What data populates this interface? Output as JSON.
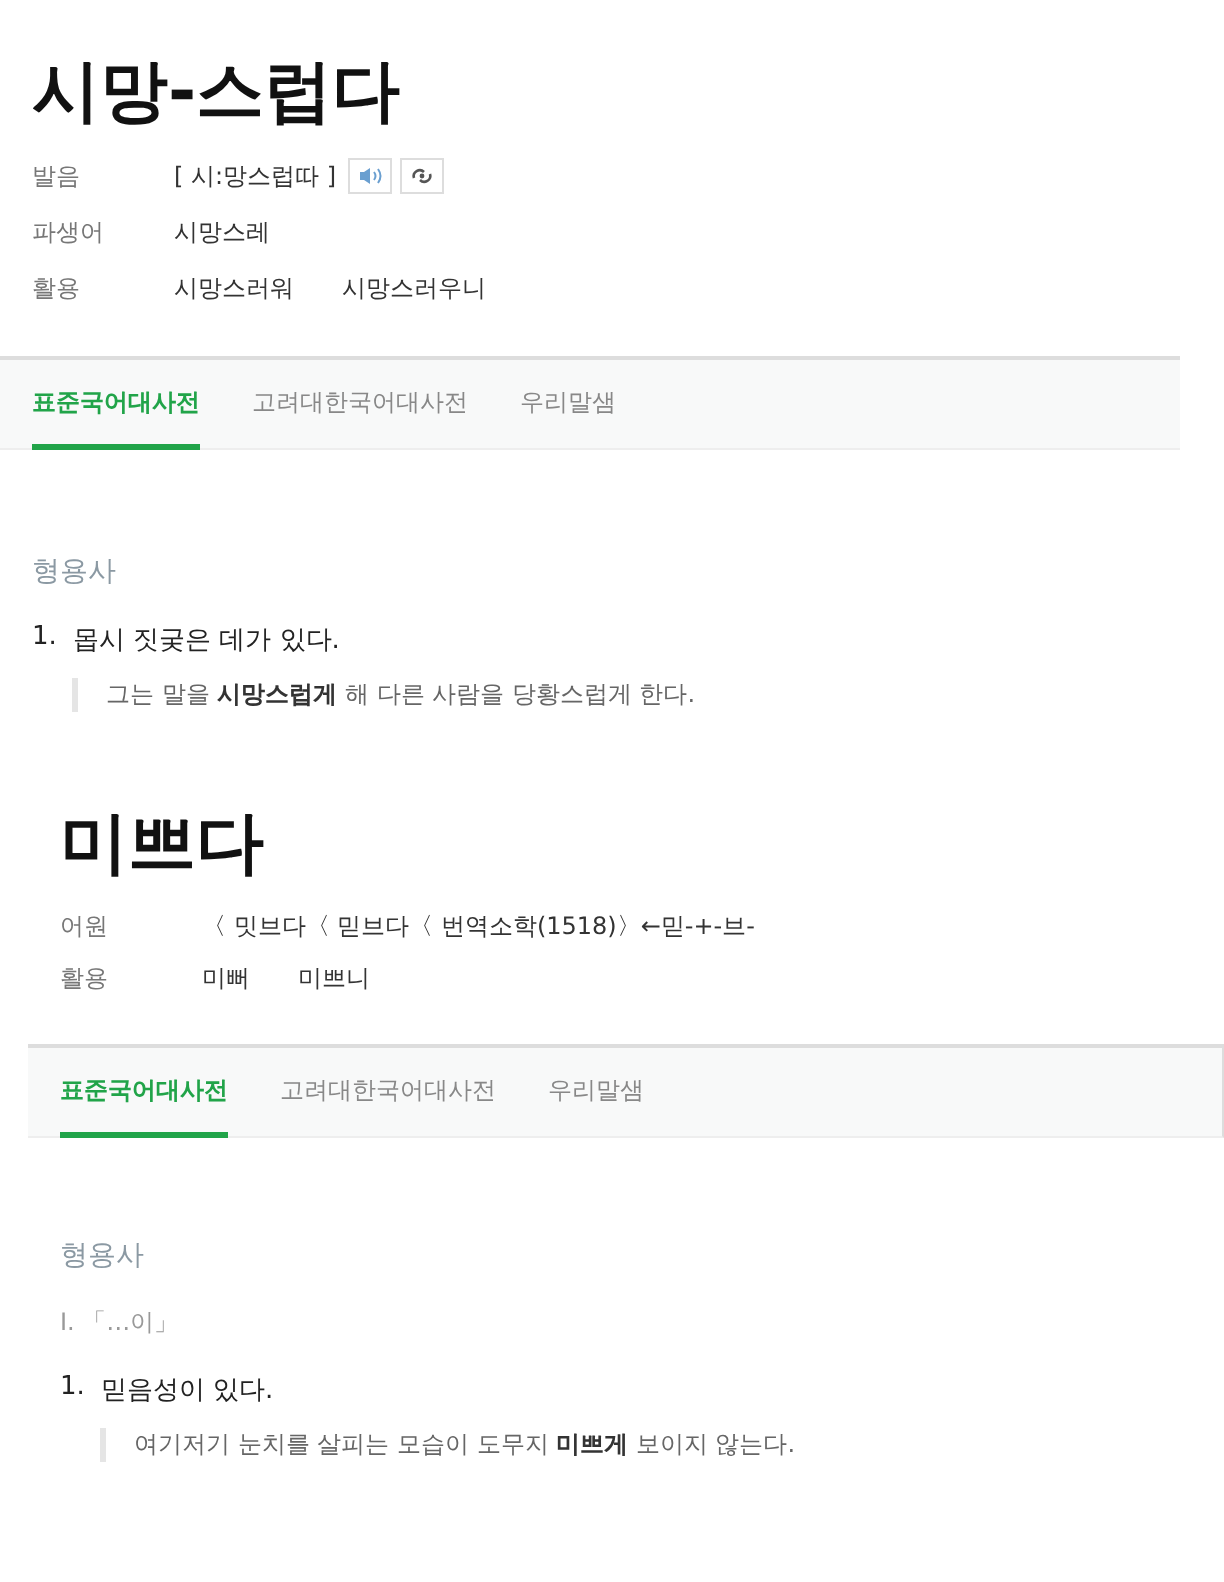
{
  "entries": [
    {
      "headword": "시망-스럽다",
      "info": [
        {
          "kind": "pronunciation",
          "label": "발음",
          "values": [
            "[ 시:망스럽따 ]"
          ]
        },
        {
          "kind": "plain",
          "label": "파생어",
          "values": [
            "시망스레"
          ]
        },
        {
          "kind": "plain",
          "label": "활용",
          "values": [
            "시망스러워",
            "시망스러우니"
          ]
        }
      ],
      "tabs": [
        {
          "label": "표준국어대사전",
          "selected": true
        },
        {
          "label": "고려대한국어대사전",
          "selected": false
        },
        {
          "label": "우리말샘",
          "selected": false
        }
      ],
      "pos": "형용사",
      "groups": [
        {
          "senses": [
            {
              "number": "1.",
              "definition": "몹시 짓궂은 데가 있다.",
              "example": "그는 말을 **시망스럽게** 해 다른 사람을 당황스럽게 한다."
            }
          ]
        }
      ]
    },
    {
      "headword": "미쁘다",
      "info": [
        {
          "kind": "plain",
          "label": "어원",
          "values": [
            "〈 밋브다〈 믿브다〈 번역소학(1518)〉←믿-+-브-"
          ]
        },
        {
          "kind": "plain",
          "label": "활용",
          "values": [
            "미뻐",
            "미쁘니"
          ]
        }
      ],
      "tabs": [
        {
          "label": "표준국어대사전",
          "selected": true
        },
        {
          "label": "고려대한국어대사전",
          "selected": false
        },
        {
          "label": "우리말샘",
          "selected": false
        }
      ],
      "pos": "형용사",
      "groups": [
        {
          "heading": "Ⅰ. 「…이」",
          "senses": [
            {
              "number": "1.",
              "definition": "믿음성이 있다.",
              "example": "여기저기 눈치를 살피는 모습이 도무지 **미쁘게** 보이지 않는다."
            }
          ]
        }
      ]
    }
  ]
}
